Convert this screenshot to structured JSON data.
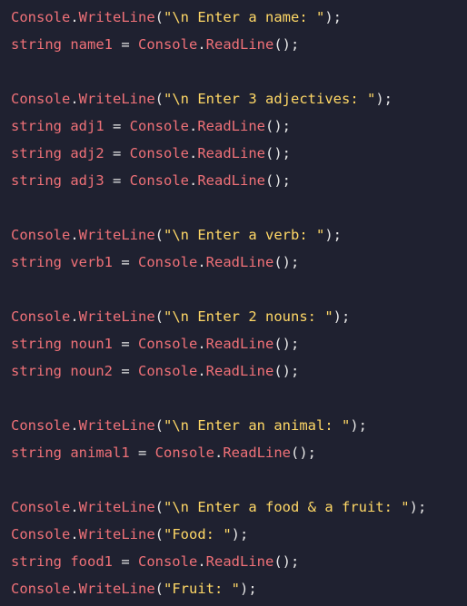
{
  "editor": {
    "lines": [
      [
        [
          "pink",
          "Console"
        ],
        [
          "light",
          "."
        ],
        [
          "pink",
          "WriteLine"
        ],
        [
          "light",
          "("
        ],
        [
          "yellow",
          "\"\\n Enter a name: \""
        ],
        [
          "light",
          ");"
        ]
      ],
      [
        [
          "pink",
          "string name1"
        ],
        [
          "light",
          " = "
        ],
        [
          "pink",
          "Console"
        ],
        [
          "light",
          "."
        ],
        [
          "pink",
          "ReadLine"
        ],
        [
          "light",
          "();"
        ]
      ],
      [],
      [
        [
          "pink",
          "Console"
        ],
        [
          "light",
          "."
        ],
        [
          "pink",
          "WriteLine"
        ],
        [
          "light",
          "("
        ],
        [
          "yellow",
          "\"\\n Enter 3 adjectives: \""
        ],
        [
          "light",
          ");"
        ]
      ],
      [
        [
          "pink",
          "string adj1"
        ],
        [
          "light",
          " = "
        ],
        [
          "pink",
          "Console"
        ],
        [
          "light",
          "."
        ],
        [
          "pink",
          "ReadLine"
        ],
        [
          "light",
          "();"
        ]
      ],
      [
        [
          "pink",
          "string adj2"
        ],
        [
          "light",
          " = "
        ],
        [
          "pink",
          "Console"
        ],
        [
          "light",
          "."
        ],
        [
          "pink",
          "ReadLine"
        ],
        [
          "light",
          "();"
        ]
      ],
      [
        [
          "pink",
          "string adj3"
        ],
        [
          "light",
          " = "
        ],
        [
          "pink",
          "Console"
        ],
        [
          "light",
          "."
        ],
        [
          "pink",
          "ReadLine"
        ],
        [
          "light",
          "();"
        ]
      ],
      [],
      [
        [
          "pink",
          "Console"
        ],
        [
          "light",
          "."
        ],
        [
          "pink",
          "WriteLine"
        ],
        [
          "light",
          "("
        ],
        [
          "yellow",
          "\"\\n Enter a verb: \""
        ],
        [
          "light",
          ");"
        ]
      ],
      [
        [
          "pink",
          "string verb1"
        ],
        [
          "light",
          " = "
        ],
        [
          "pink",
          "Console"
        ],
        [
          "light",
          "."
        ],
        [
          "pink",
          "ReadLine"
        ],
        [
          "light",
          "();"
        ]
      ],
      [],
      [
        [
          "pink",
          "Console"
        ],
        [
          "light",
          "."
        ],
        [
          "pink",
          "WriteLine"
        ],
        [
          "light",
          "("
        ],
        [
          "yellow",
          "\"\\n Enter 2 nouns: \""
        ],
        [
          "light",
          ");"
        ]
      ],
      [
        [
          "pink",
          "string noun1"
        ],
        [
          "light",
          " = "
        ],
        [
          "pink",
          "Console"
        ],
        [
          "light",
          "."
        ],
        [
          "pink",
          "ReadLine"
        ],
        [
          "light",
          "();"
        ]
      ],
      [
        [
          "pink",
          "string noun2"
        ],
        [
          "light",
          " = "
        ],
        [
          "pink",
          "Console"
        ],
        [
          "light",
          "."
        ],
        [
          "pink",
          "ReadLine"
        ],
        [
          "light",
          "();"
        ]
      ],
      [],
      [
        [
          "pink",
          "Console"
        ],
        [
          "light",
          "."
        ],
        [
          "pink",
          "WriteLine"
        ],
        [
          "light",
          "("
        ],
        [
          "yellow",
          "\"\\n Enter an animal: \""
        ],
        [
          "light",
          ");"
        ]
      ],
      [
        [
          "pink",
          "string animal1"
        ],
        [
          "light",
          " = "
        ],
        [
          "pink",
          "Console"
        ],
        [
          "light",
          "."
        ],
        [
          "pink",
          "ReadLine"
        ],
        [
          "light",
          "();"
        ]
      ],
      [],
      [
        [
          "pink",
          "Console"
        ],
        [
          "light",
          "."
        ],
        [
          "pink",
          "WriteLine"
        ],
        [
          "light",
          "("
        ],
        [
          "yellow",
          "\"\\n Enter a food & a fruit: \""
        ],
        [
          "light",
          ");"
        ]
      ],
      [
        [
          "pink",
          "Console"
        ],
        [
          "light",
          "."
        ],
        [
          "pink",
          "WriteLine"
        ],
        [
          "light",
          "("
        ],
        [
          "yellow",
          "\"Food: \""
        ],
        [
          "light",
          ");"
        ]
      ],
      [
        [
          "pink",
          "string food1"
        ],
        [
          "light",
          " = "
        ],
        [
          "pink",
          "Console"
        ],
        [
          "light",
          "."
        ],
        [
          "pink",
          "ReadLine"
        ],
        [
          "light",
          "();"
        ]
      ],
      [
        [
          "pink",
          "Console"
        ],
        [
          "light",
          "."
        ],
        [
          "pink",
          "WriteLine"
        ],
        [
          "light",
          "("
        ],
        [
          "yellow",
          "\"Fruit: \""
        ],
        [
          "light",
          ");"
        ]
      ]
    ]
  }
}
